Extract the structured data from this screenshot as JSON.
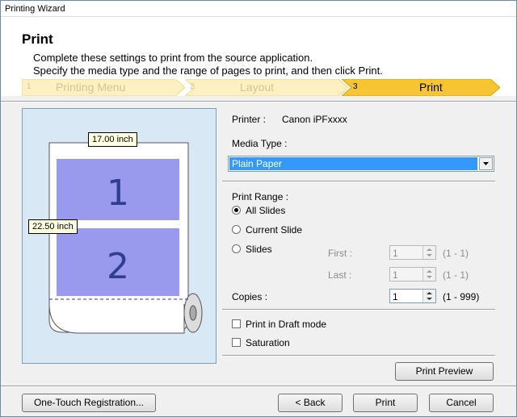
{
  "window": {
    "title": "Printing Wizard"
  },
  "header": {
    "title": "Print",
    "desc_line1": "Complete these settings to print from the source application.",
    "desc_line2": "Specify the media type and the range of pages to print, and then click Print."
  },
  "steps": [
    {
      "num": "1",
      "label": "Printing Menu",
      "state": "inactive"
    },
    {
      "num": "2",
      "label": "Layout",
      "state": "inactive"
    },
    {
      "num": "3",
      "label": "Print",
      "state": "active"
    }
  ],
  "preview": {
    "width_label": "17.00 inch",
    "height_label": "22.50 inch",
    "pages": [
      "1",
      "2"
    ],
    "colors": {
      "panel_bg": "#d9e8f5",
      "page_fill": "#9999ee",
      "step_active": "#f7c531"
    }
  },
  "printer": {
    "label": "Printer :",
    "name": "Canon iPFxxxx"
  },
  "media_type": {
    "label": "Media Type :",
    "value": "Plain Paper"
  },
  "print_range": {
    "label": "Print Range :",
    "options": [
      {
        "label": "All Slides",
        "selected": true
      },
      {
        "label": "Current Slide",
        "selected": false
      },
      {
        "label": "Slides",
        "selected": false
      }
    ],
    "first": {
      "label": "First :",
      "value": "1",
      "range": "(1 - 1)"
    },
    "last": {
      "label": "Last :",
      "value": "1",
      "range": "(1 - 1)"
    }
  },
  "copies": {
    "label": "Copies :",
    "value": "1",
    "range": "(1 - 999)"
  },
  "checkboxes": {
    "draft": {
      "label": "Print in Draft mode",
      "checked": false
    },
    "saturation": {
      "label": "Saturation",
      "checked": false
    }
  },
  "buttons": {
    "preview": "Print Preview",
    "registration": "One-Touch Registration...",
    "back": "< Back",
    "print": "Print",
    "cancel": "Cancel"
  }
}
